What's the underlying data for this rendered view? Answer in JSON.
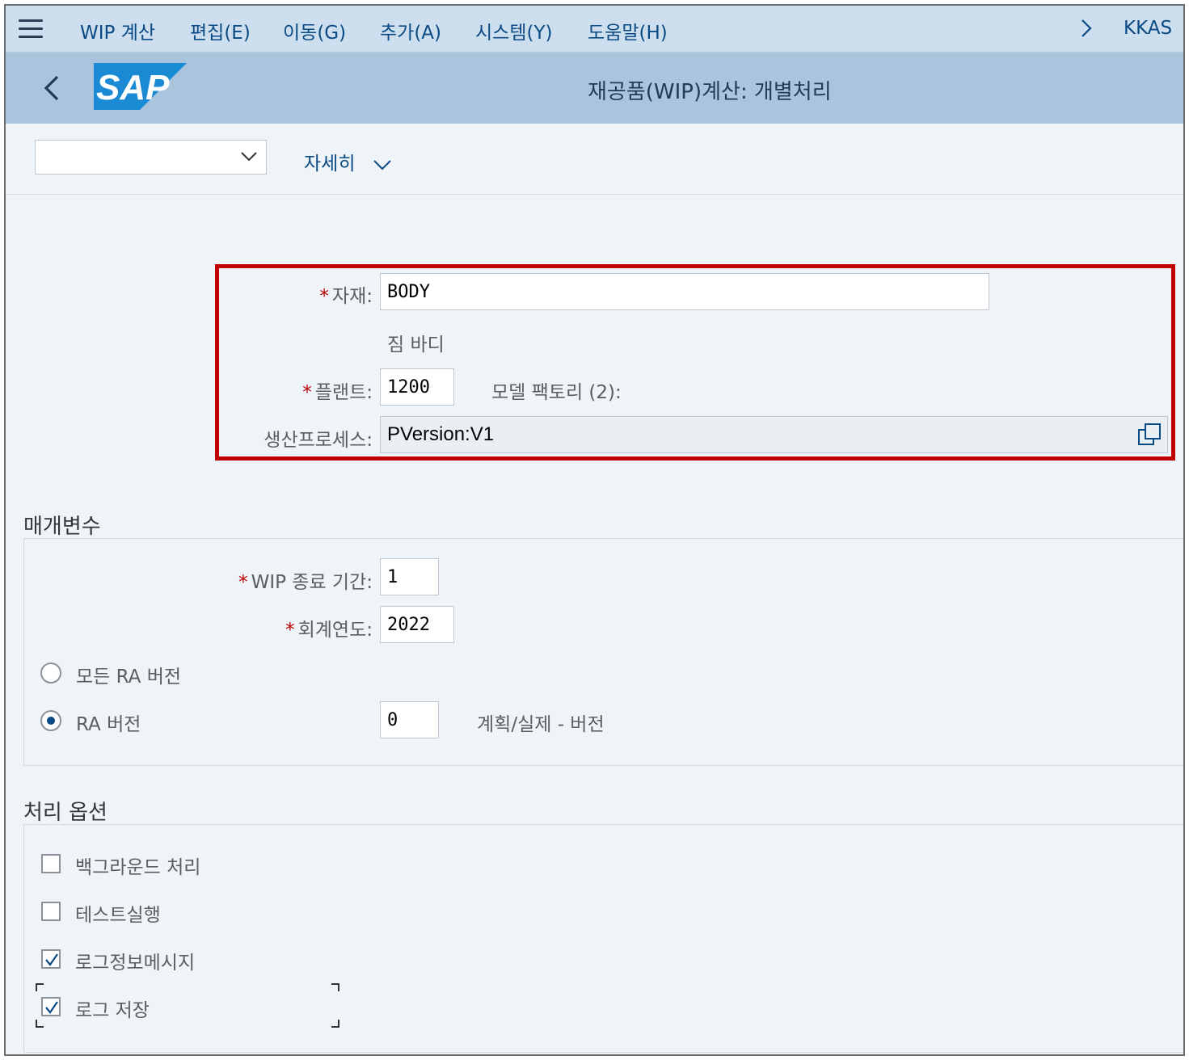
{
  "menu": {
    "items": [
      "WIP 계산",
      "편집(E)",
      "이동(G)",
      "추가(A)",
      "시스템(Y)",
      "도움말(H)"
    ],
    "tcode": "KKAS"
  },
  "title": {
    "logo_text": "SAP",
    "page_title": "재공품(WIP)계산: 개별처리"
  },
  "toolbar": {
    "variant_value": "",
    "details_label": "자세히"
  },
  "header_fields": {
    "material": {
      "label": "자재:",
      "value": "BODY",
      "description": "짐 바디"
    },
    "plant": {
      "label": "플랜트:",
      "value": "1200",
      "description": "모델 팩토리 (2):"
    },
    "production_process": {
      "label": "생산프로세스:",
      "value": "PVersion:V1"
    }
  },
  "parameters": {
    "section_title": "매개변수",
    "wip_to_period": {
      "label": "WIP 종료 기간:",
      "value": "1"
    },
    "fiscal_year": {
      "label": "회계연도:",
      "value": "2022"
    },
    "all_ra_versions": {
      "label": "모든 RA 버전",
      "selected": false
    },
    "ra_version": {
      "label": "RA 버전",
      "selected": true,
      "value": "0",
      "description": "계획/실제 - 버전"
    }
  },
  "processing_options": {
    "section_title": "처리 옵션",
    "background": {
      "label": "백그라운드 처리",
      "checked": false
    },
    "test_run": {
      "label": "테스트실행",
      "checked": false
    },
    "log_info_messages": {
      "label": "로그정보메시지",
      "checked": true
    },
    "save_log": {
      "label": "로그 저장",
      "checked": true
    }
  },
  "colors": {
    "menubar_bg": "#cddeee",
    "titlebar_bg": "#a9c4dc",
    "page_bg": "#eff4f9",
    "link": "#0a4a84",
    "required": "#bb0000",
    "highlight_box": "#c00000",
    "sap_logo": "#1a8ad4"
  }
}
